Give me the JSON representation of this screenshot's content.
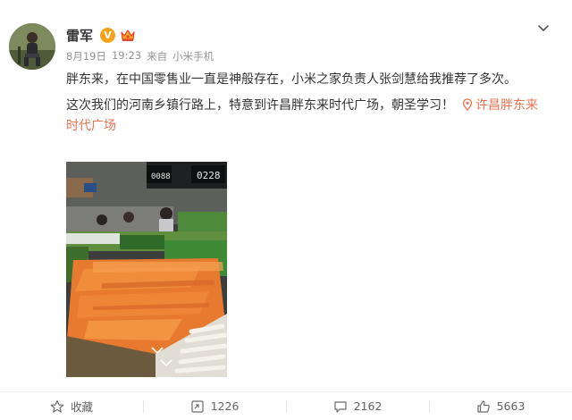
{
  "author": {
    "name": "雷军",
    "verified_badge": "V"
  },
  "meta": {
    "date": "8月19日",
    "time": "19:23",
    "source_prefix": "来自",
    "source": "小米手机"
  },
  "content": {
    "paragraph1": "胖东来，在中国零售业一直是神般存在，小米之家负责人张剑慧给我推荐了多次。",
    "paragraph2": "这次我们的河南乡镇行路上，特意到许昌胖东来时代广场，朝圣学习！",
    "location": "许昌胖东来时代广场"
  },
  "actions": {
    "favorite": "收藏",
    "repost": "1226",
    "comment": "2162",
    "like": "5663"
  },
  "colors": {
    "location_accent": "#eb7350",
    "verified_badge": "#f7a21c"
  },
  "icons": [
    "chevron-down-icon",
    "location-pin-icon",
    "star-icon",
    "repost-icon",
    "comment-icon",
    "thumbs-up-icon",
    "crown-icon"
  ]
}
